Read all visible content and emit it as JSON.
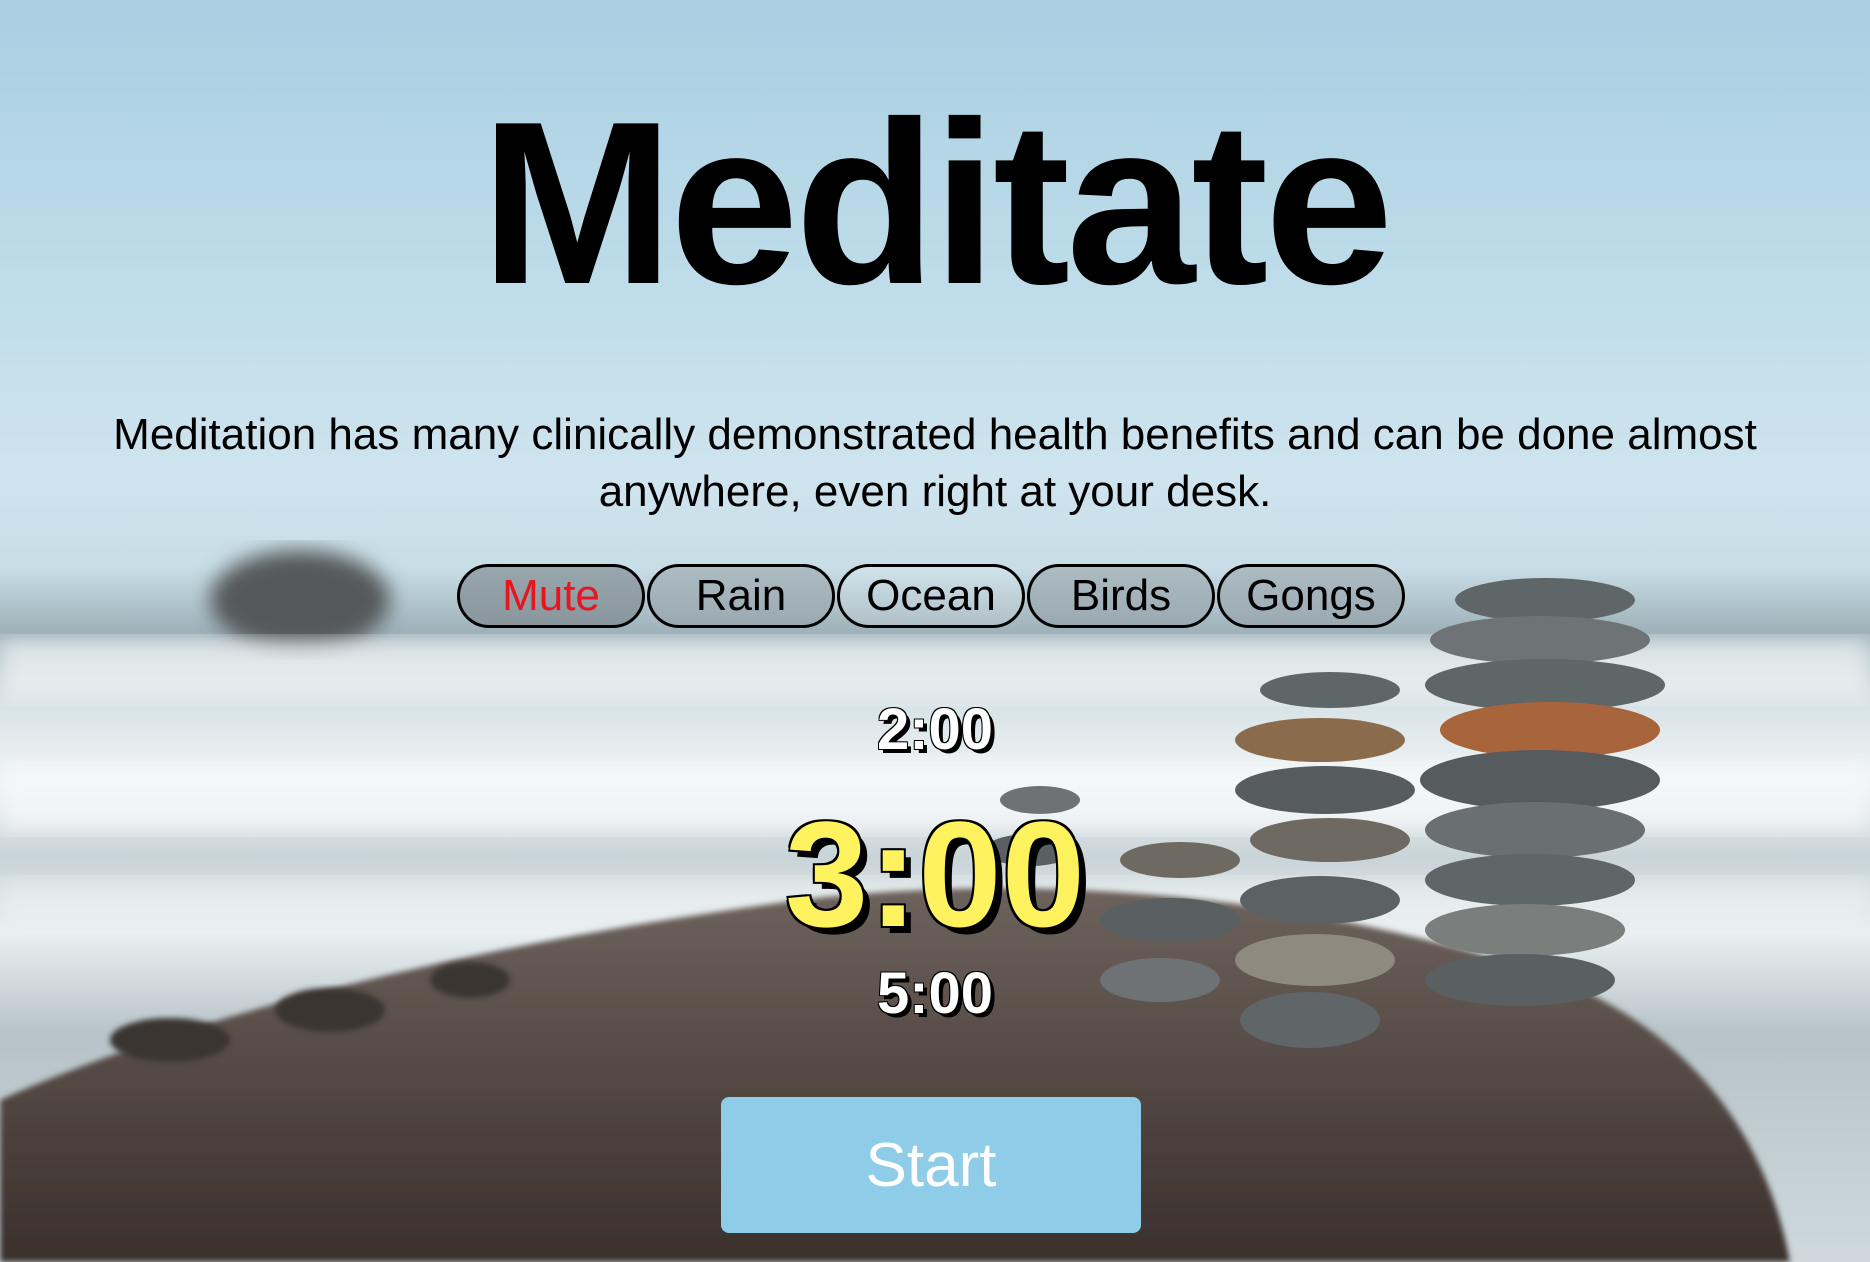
{
  "title": "Meditate",
  "description": "Meditation has many clinically demonstrated health benefits and can be done almost anywhere, even right at your desk.",
  "sounds": [
    {
      "label": "Mute",
      "active": true
    },
    {
      "label": "Rain",
      "active": false
    },
    {
      "label": "Ocean",
      "active": false
    },
    {
      "label": "Birds",
      "active": false
    },
    {
      "label": "Gongs",
      "active": false
    }
  ],
  "durations": {
    "previous": "2:00",
    "selected": "3:00",
    "next": "5:00"
  },
  "start_label": "Start",
  "colors": {
    "active_sound": "#e8141e",
    "selected_time": "#fef35e",
    "start_button": "#8ecce8"
  }
}
